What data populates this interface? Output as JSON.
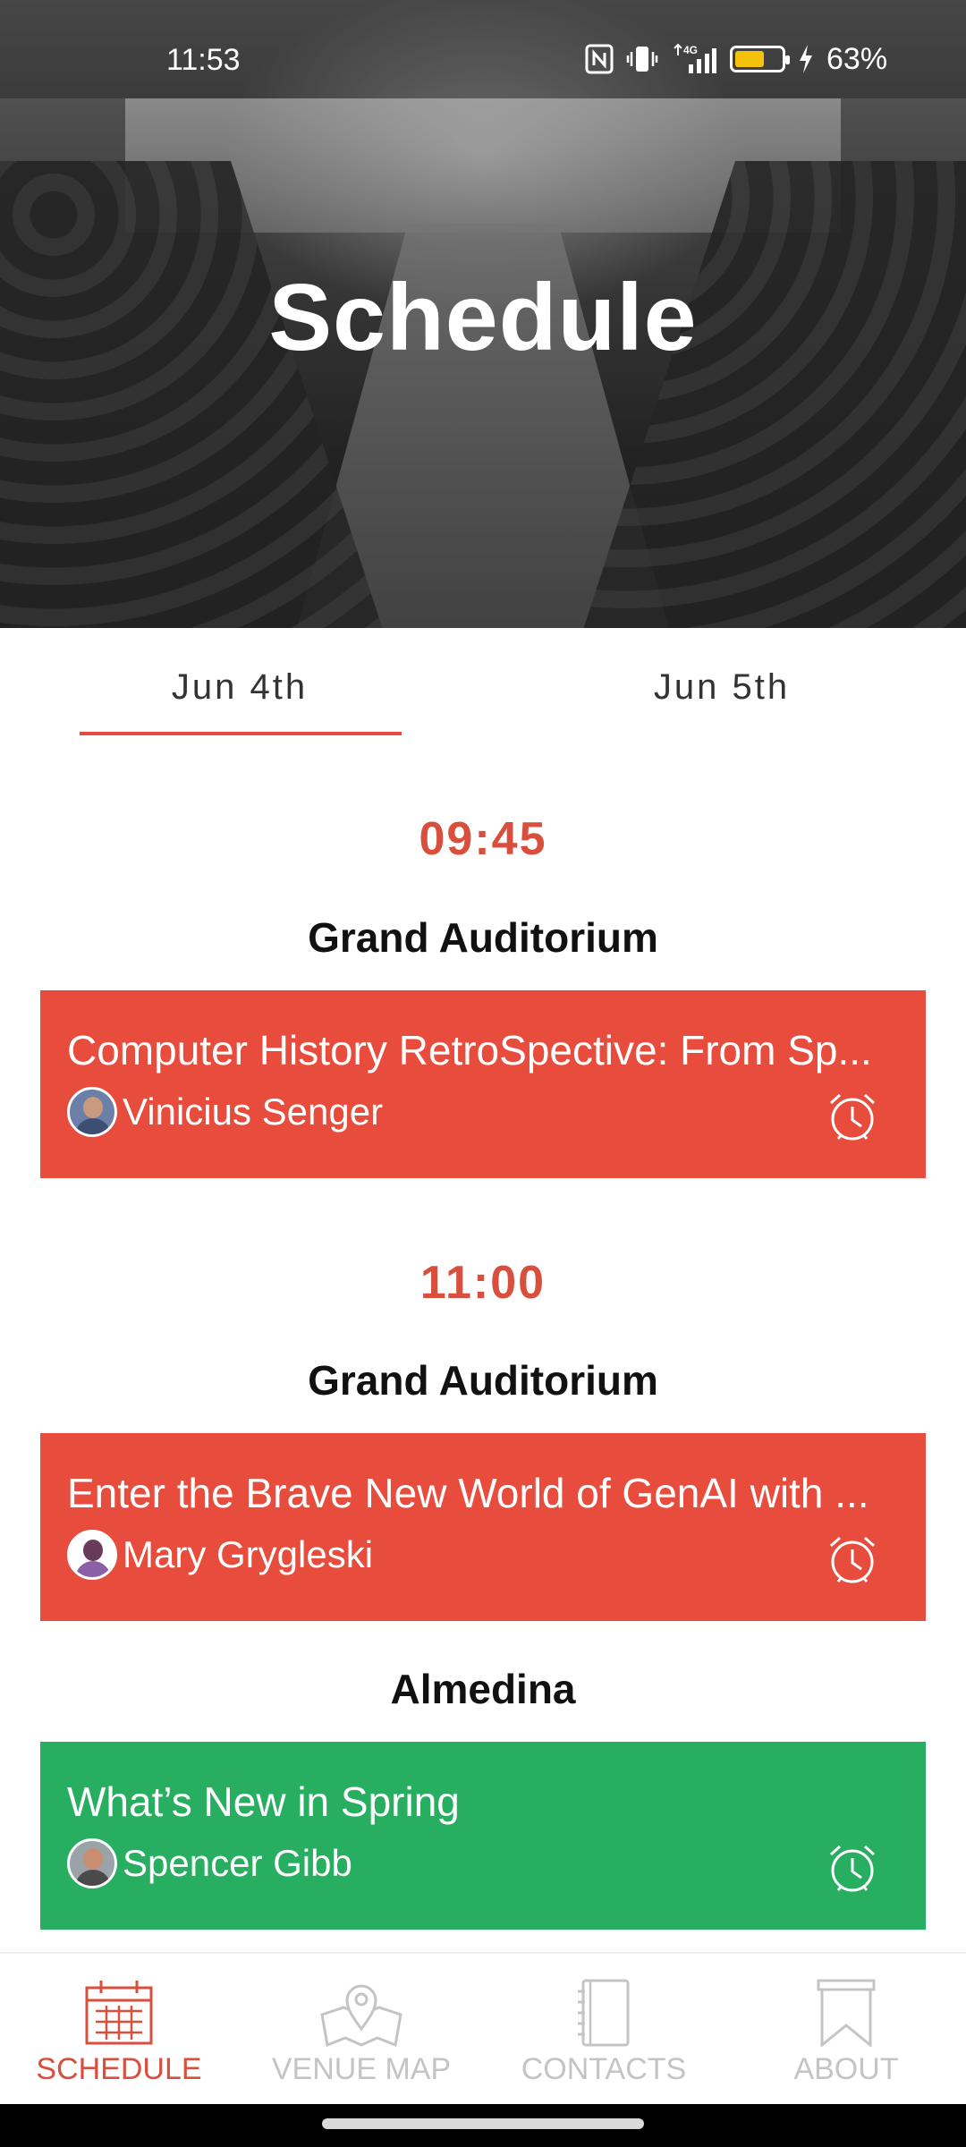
{
  "status_bar": {
    "time": "11:53",
    "battery_percent_label": "63%",
    "battery_level": 0.63,
    "icons": [
      "nfc-icon",
      "vibrate-icon",
      "4g-signal-icon",
      "battery-icon",
      "charging-icon"
    ]
  },
  "hero": {
    "title": "Schedule"
  },
  "tabs": [
    {
      "label": "Jun 4th",
      "selected": true
    },
    {
      "label": "Jun 5th",
      "selected": false
    }
  ],
  "schedule": [
    {
      "time": "09:45",
      "room": "Grand Auditorium",
      "session": {
        "title": "Computer History RetroSpective: From Sp...",
        "speaker": "Vinicius Senger",
        "color": "#e74c3c"
      }
    },
    {
      "time": "11:00",
      "room": "Grand Auditorium",
      "session": {
        "title": "Enter the Brave New World of GenAI with ...",
        "speaker": "Mary Grygleski",
        "color": "#e74c3c"
      }
    },
    {
      "room": "Almedina",
      "session": {
        "title": "What’s New in Spring",
        "speaker": "Spencer Gibb",
        "color": "#27ae60"
      }
    }
  ],
  "bottom_nav": [
    {
      "label": "SCHEDULE",
      "icon": "calendar-icon",
      "active": true
    },
    {
      "label": "VENUE MAP",
      "icon": "map-pin-icon",
      "active": false
    },
    {
      "label": "CONTACTS",
      "icon": "phone-book-icon",
      "active": false
    },
    {
      "label": "ABOUT",
      "icon": "bookmark-icon",
      "active": false
    }
  ],
  "colors": {
    "accent": "#e74c3c",
    "accent_text": "#d94f3d",
    "green": "#27ae60",
    "nav_inactive": "#c4c4c4"
  }
}
